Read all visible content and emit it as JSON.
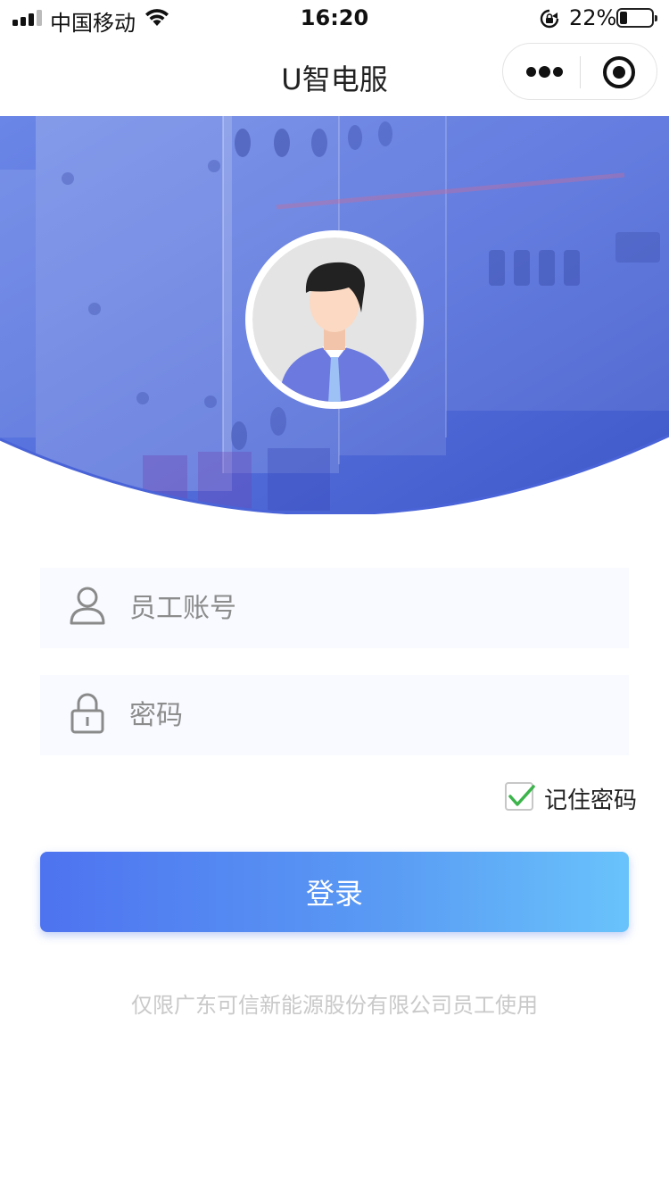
{
  "status_bar": {
    "carrier": "中国移动",
    "time": "16:20",
    "battery_percent": "22%",
    "battery_level": 0.22,
    "icons": [
      "signal-icon",
      "wifi-icon",
      "rotation-lock-icon",
      "battery-icon"
    ]
  },
  "nav": {
    "title": "U智电服",
    "capsule_icons": [
      "more-icon",
      "close-target-icon"
    ]
  },
  "login": {
    "username_placeholder": "员工账号",
    "password_placeholder": "密码",
    "remember_label": "记住密码",
    "remember_checked": true,
    "submit_label": "登录"
  },
  "footer": {
    "note": "仅限广东可信新能源股份有限公司员工使用"
  },
  "colors": {
    "brand_blue": "#4a64d8",
    "button_gradient_start": "#4e73f0",
    "button_gradient_end": "#69c3fb",
    "checkmark_green": "#3cb44b"
  }
}
